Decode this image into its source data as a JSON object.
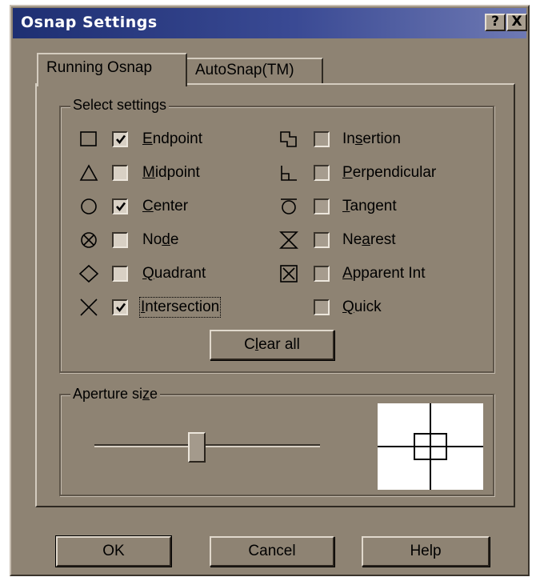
{
  "window": {
    "title": "Osnap Settings",
    "help_glyph": "?",
    "close_glyph": "X"
  },
  "tabs": [
    {
      "label": "Running Osnap",
      "active": true
    },
    {
      "label": "AutoSnap(TM)",
      "active": false
    }
  ],
  "select_settings": {
    "group_label": "Select settings",
    "options": [
      {
        "label": "Endpoint",
        "checked": true,
        "enabled": true,
        "icon": "endpoint-square-icon"
      },
      {
        "label": "Midpoint",
        "checked": false,
        "enabled": true,
        "icon": "midpoint-triangle-icon"
      },
      {
        "label": "Center",
        "checked": true,
        "enabled": true,
        "icon": "center-circle-icon"
      },
      {
        "label": "Node",
        "checked": false,
        "enabled": true,
        "icon": "node-circle-x-icon"
      },
      {
        "label": "Quadrant",
        "checked": false,
        "enabled": true,
        "icon": "quadrant-diamond-icon"
      },
      {
        "label": "Intersection",
        "checked": true,
        "enabled": true,
        "icon": "intersection-x-icon"
      },
      {
        "label": "Insertion",
        "checked": false,
        "enabled": false,
        "icon": "insertion-icon"
      },
      {
        "label": "Perpendicular",
        "checked": false,
        "enabled": false,
        "icon": "perpendicular-icon"
      },
      {
        "label": "Tangent",
        "checked": false,
        "enabled": false,
        "icon": "tangent-icon"
      },
      {
        "label": "Nearest",
        "checked": false,
        "enabled": false,
        "icon": "nearest-hourglass-icon"
      },
      {
        "label": "Apparent Int",
        "checked": false,
        "enabled": false,
        "icon": "apparent-int-icon"
      },
      {
        "label": "Quick",
        "checked": false,
        "enabled": false,
        "icon": ""
      }
    ],
    "clear_all_label": "Clear all"
  },
  "aperture": {
    "group_label": "Aperture size",
    "slider_fraction": 0.45
  },
  "buttons": {
    "ok": "OK",
    "cancel": "Cancel",
    "help": "Help"
  },
  "colors": {
    "dialog_face": "#8e8373",
    "title_gradient_start": "#1e2f72",
    "title_text": "#ffffff"
  }
}
